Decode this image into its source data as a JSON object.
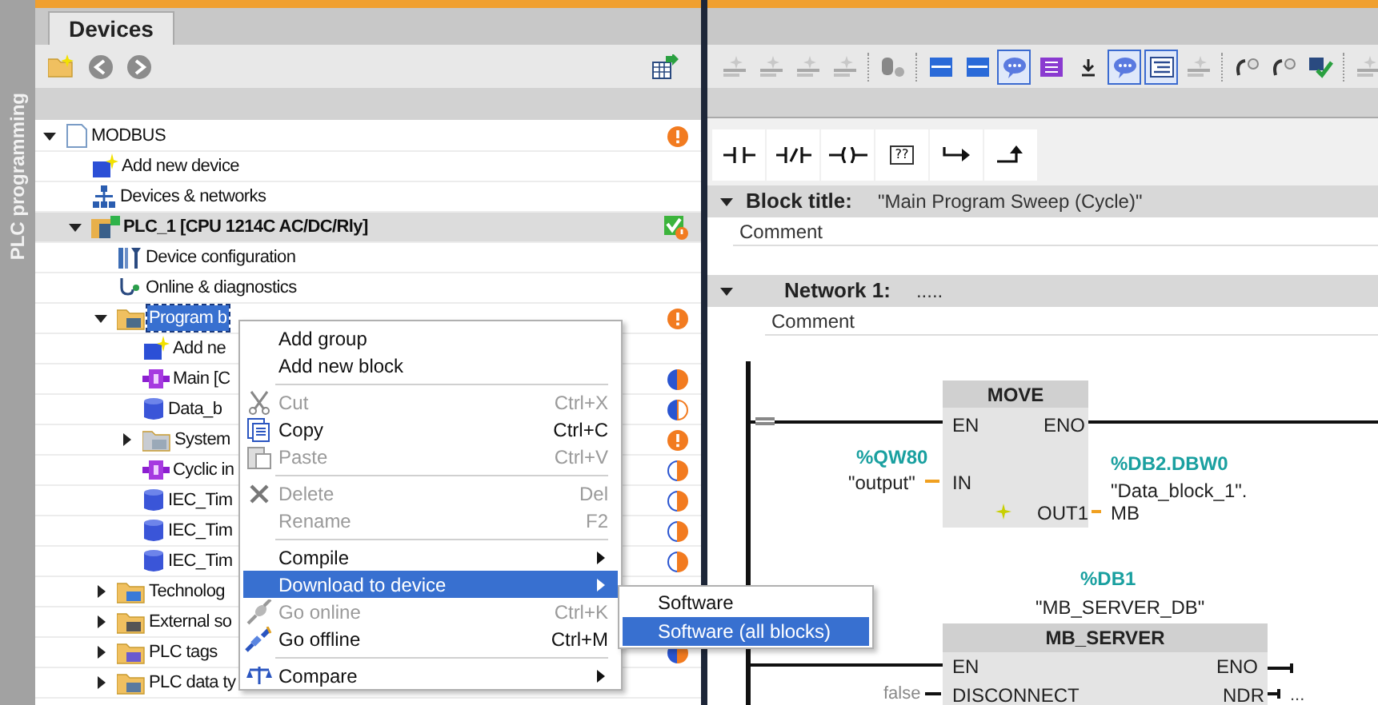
{
  "side_tab": {
    "label": "PLC programming"
  },
  "project_tree": {
    "tab": {
      "label": "Devices",
      "selected": true
    },
    "items": [
      {
        "kind": "project",
        "label": "MODBUS",
        "status": {
          "kind": "warning"
        },
        "expanded": true,
        "selected": false,
        "children": [
          {
            "kind": "add_device",
            "label": "Add new device",
            "selected": false
          },
          {
            "kind": "network",
            "label": "Devices & networks",
            "selected": false
          },
          {
            "kind": "device",
            "label": "PLC_1 [CPU 1214C AC/DC/Rly]",
            "status": {
              "kind": "device"
            },
            "expanded": true,
            "selected": false,
            "children": [
              {
                "kind": "config",
                "label": "Device configuration",
                "selected": false
              },
              {
                "kind": "online",
                "label": "Online & diagnostics",
                "selected": false
              },
              {
                "kind": "folder",
                "label": "Program b",
                "status": {
                  "kind": "warning"
                },
                "expanded": true,
                "selected": true,
                "children": [
                  {
                    "kind": "add_block",
                    "label": "Add ne",
                    "selected": false
                  },
                  {
                    "kind": "ob",
                    "label": "Main [C",
                    "status": {
                      "kind": "blue_orange"
                    },
                    "selected": false
                  },
                  {
                    "kind": "db",
                    "label": "Data_b",
                    "status": {
                      "kind": "blue_white"
                    },
                    "selected": false
                  },
                  {
                    "kind": "system_folder",
                    "label": "System",
                    "status": {
                      "kind": "warning"
                    },
                    "expanded": false,
                    "selected": false
                  },
                  {
                    "kind": "ob",
                    "label": "Cyclic in",
                    "status": {
                      "kind": "white_orange"
                    },
                    "selected": false
                  },
                  {
                    "kind": "db",
                    "label": "IEC_Tim",
                    "status": {
                      "kind": "white_orange"
                    },
                    "selected": false
                  },
                  {
                    "kind": "db",
                    "label": "IEC_Tim",
                    "status": {
                      "kind": "white_orange"
                    },
                    "selected": false
                  },
                  {
                    "kind": "db",
                    "label": "IEC_Tim",
                    "status": {
                      "kind": "white_orange"
                    },
                    "selected": false
                  }
                ]
              },
              {
                "kind": "tech_folder",
                "label": "Technolog",
                "expanded": false,
                "selected": false
              },
              {
                "kind": "ext_folder",
                "label": "External so",
                "expanded": false,
                "selected": false
              },
              {
                "kind": "tag_folder",
                "label": "PLC tags",
                "status": {
                  "kind": "blue_orange"
                },
                "expanded": false,
                "selected": false
              },
              {
                "kind": "type_folder",
                "label": "PLC data ty",
                "expanded": false,
                "selected": false
              }
            ]
          }
        ]
      }
    ]
  },
  "context_menu": {
    "items": [
      {
        "kind": "plain",
        "label": "Add group",
        "disabled": false,
        "selected": false,
        "submenu": false
      },
      {
        "kind": "plain",
        "label": "Add new block",
        "disabled": false,
        "selected": false,
        "submenu": false
      },
      {
        "kind": "separator"
      },
      {
        "kind": "cut",
        "label": "Cut",
        "shortcut": "Ctrl+X",
        "disabled": true,
        "selected": false,
        "submenu": false
      },
      {
        "kind": "copy",
        "label": "Copy",
        "shortcut": "Ctrl+C",
        "disabled": false,
        "selected": false,
        "submenu": false
      },
      {
        "kind": "paste",
        "label": "Paste",
        "shortcut": "Ctrl+V",
        "disabled": true,
        "selected": false,
        "submenu": false
      },
      {
        "kind": "separator"
      },
      {
        "kind": "delete",
        "label": "Delete",
        "shortcut": "Del",
        "disabled": true,
        "selected": false,
        "submenu": false
      },
      {
        "kind": "plain",
        "label": "Rename",
        "shortcut": "F2",
        "disabled": true,
        "selected": false,
        "submenu": false
      },
      {
        "kind": "separator"
      },
      {
        "kind": "plain",
        "label": "Compile",
        "disabled": false,
        "selected": false,
        "submenu": true
      },
      {
        "kind": "plain",
        "label": "Download to device",
        "disabled": false,
        "selected": true,
        "submenu": true
      },
      {
        "kind": "online",
        "label": "Go online",
        "shortcut": "Ctrl+K",
        "disabled": true,
        "selected": false,
        "submenu": false
      },
      {
        "kind": "offline",
        "label": "Go offline",
        "shortcut": "Ctrl+M",
        "disabled": false,
        "selected": false,
        "submenu": false
      },
      {
        "kind": "separator"
      },
      {
        "kind": "compare",
        "label": "Compare",
        "disabled": false,
        "selected": false,
        "submenu": true
      }
    ]
  },
  "submenu": {
    "items": [
      {
        "label": "Software",
        "selected": false
      },
      {
        "label": "Software (all blocks)",
        "selected": true
      }
    ]
  },
  "editor": {
    "toolbar": [
      {
        "kind": "disabled",
        "pressed": false
      },
      {
        "kind": "disabled",
        "pressed": false
      },
      {
        "kind": "disabled",
        "pressed": false
      },
      {
        "kind": "disabled",
        "pressed": false
      },
      {
        "kind": "separator"
      },
      {
        "kind": "database",
        "pressed": false
      },
      {
        "kind": "separator"
      },
      {
        "kind": "network",
        "pressed": false
      },
      {
        "kind": "network",
        "pressed": false
      },
      {
        "kind": "comment",
        "pressed": true
      },
      {
        "kind": "tag",
        "pressed": false
      },
      {
        "kind": "download",
        "pressed": false
      },
      {
        "kind": "comment",
        "pressed": true
      },
      {
        "kind": "list",
        "pressed": true
      },
      {
        "kind": "disabled",
        "pressed": false
      },
      {
        "kind": "separator"
      },
      {
        "kind": "call",
        "pressed": false
      },
      {
        "kind": "call",
        "pressed": false
      },
      {
        "kind": "check",
        "pressed": false
      },
      {
        "kind": "separator"
      },
      {
        "kind": "disabled",
        "pressed": false
      }
    ],
    "lad_elements": [
      {
        "kind": "no_contact"
      },
      {
        "kind": "nc_contact"
      },
      {
        "kind": "coil"
      },
      {
        "kind": "empty_box",
        "label": "??"
      },
      {
        "kind": "open_branch"
      },
      {
        "kind": "close_branch"
      }
    ],
    "block_title": {
      "label": "Block title:",
      "value": "\"Main Program Sweep (Cycle)\"",
      "comment": "Comment",
      "expanded": true
    },
    "network": {
      "label": "Network 1:",
      "value": ".....",
      "comment": "Comment",
      "expanded": true
    },
    "move_box": {
      "title": "MOVE",
      "en": "EN",
      "eno": "ENO",
      "in": "IN",
      "out": "OUT1",
      "in_address": "%QW80",
      "in_tag": "\"output\"",
      "out_address": "%DB2.DBW0",
      "out_tag": "\"Data_block_1\".",
      "out_member": "MB"
    },
    "server_box": {
      "instance_address": "%DB1",
      "instance_tag": "\"MB_SERVER_DB\"",
      "title": "MB_SERVER",
      "en": "EN",
      "eno": "ENO",
      "disconnect_value": "false",
      "disconnect": "DISCONNECT",
      "ndr": "NDR",
      "ndr_value": "..."
    }
  }
}
